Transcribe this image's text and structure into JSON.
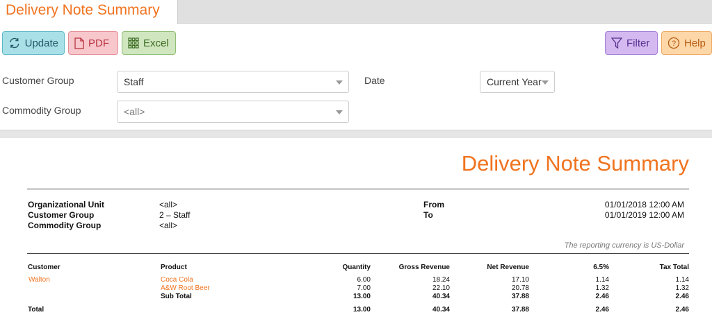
{
  "tab": {
    "title": "Delivery Note Summary"
  },
  "toolbar": {
    "update": "Update",
    "pdf": "PDF",
    "excel": "Excel",
    "filter": "Filter",
    "help": "Help"
  },
  "filters": {
    "customer_group_label": "Customer Group",
    "customer_group_value": "Staff",
    "commodity_group_label": "Commodity Group",
    "commodity_group_value": "<all>",
    "date_label": "Date",
    "date_value": "Current Year"
  },
  "report": {
    "title": "Delivery Note Summary",
    "info": {
      "org_unit_label": "Organizational Unit",
      "org_unit_value": "<all>",
      "customer_group_label": "Customer Group",
      "customer_group_value": "2 – Staff",
      "commodity_group_label": "Commodity Group",
      "commodity_group_value": "<all>",
      "from_label": "From",
      "from_value": "01/01/2018 12:00 AM",
      "to_label": "To",
      "to_value": "01/01/2019 12:00 AM"
    },
    "currency_note": "The reporting currency is US-Dollar",
    "columns": {
      "customer": "Customer",
      "product": "Product",
      "quantity": "Quantity",
      "gross": "Gross Revenue",
      "net": "Net Revenue",
      "tax_rate": "6.5%",
      "tax_total": "Tax Total"
    },
    "rows": [
      {
        "customer": "Walton",
        "product": "Coca Cola",
        "quantity": "6.00",
        "gross": "18.24",
        "net": "17.10",
        "tax_rate": "1.14",
        "tax_total": "1.14"
      },
      {
        "customer": "",
        "product": "A&W Root Beer",
        "quantity": "7.00",
        "gross": "22.10",
        "net": "20.78",
        "tax_rate": "1.32",
        "tax_total": "1.32"
      }
    ],
    "subtotal": {
      "label": "Sub Total",
      "quantity": "13.00",
      "gross": "40.34",
      "net": "37.88",
      "tax_rate": "2.46",
      "tax_total": "2.46"
    },
    "total": {
      "label": "Total",
      "quantity": "13.00",
      "gross": "40.34",
      "net": "37.88",
      "tax_rate": "2.46",
      "tax_total": "2.46"
    }
  },
  "colors": {
    "accent": "#f0731f"
  }
}
